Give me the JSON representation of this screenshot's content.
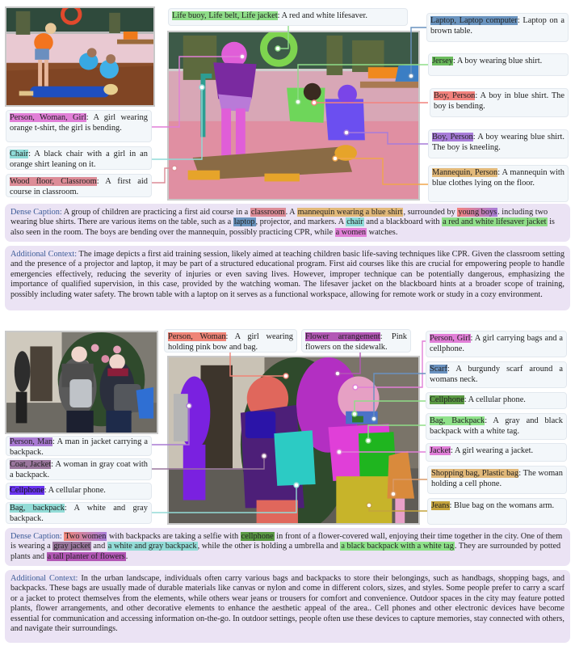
{
  "colors": {
    "girl_pink": "#e17fd7",
    "chair_teal": "#8fdcd8",
    "floor_rose": "#dc8c97",
    "lifebuoy_green": "#8fdd88",
    "laptop_blue": "#6a94bf",
    "jersey_green": "#6bbc5d",
    "boy_red": "#f2827d",
    "boy_purple": "#a77cd9",
    "mannequin_orange": "#e2b97a",
    "person_woman_red": "#ef8477",
    "flower_magenta": "#b257b5",
    "person_man_purple": "#a97ad3",
    "coat_mauve": "#9a769d",
    "cellphone_violet": "#6a35f0",
    "bag_teal": "#93dcd7",
    "scarf_blue": "#6a92c0",
    "cellphone_green": "#5b9a44",
    "backpack_green": "#8fe28a",
    "jacket_pink": "#e07ed8",
    "shopping_tan": "#e2b97a",
    "jeans_olive": "#c4a33c",
    "caption_label": "#3a5a97",
    "caption_bg": "#ebe3f4"
  },
  "panel1": {
    "annotations": {
      "girl": {
        "tag": "Person, Woman, Girl",
        "text": ": A girl wearing orange t-shirt, the girl is bending."
      },
      "chair": {
        "tag": "Chair",
        "text": ": A black chair with a girl in an orange shirt leaning on it."
      },
      "floor": {
        "tag": "Wood floor, Classroom",
        "text": ": A first aid course in classroom."
      },
      "lifebuoy": {
        "tag": "Life buoy, Life belt, Life jacket",
        "text": ":  A red and white lifesaver."
      },
      "laptop": {
        "tag": "Laptop, Laptop computer",
        "text": ": Laptop on a brown table."
      },
      "jersey": {
        "tag": "Jersey",
        "text": ": A boy wearing blue shirt."
      },
      "boy1": {
        "tag": "Boy, Person",
        "text": ": A boy in blue shirt. The boy is bending."
      },
      "boy2": {
        "tag": "Boy, Person",
        "text": ": A boy wearing blue shirt. The boy is kneeling."
      },
      "mannequin": {
        "tag": "Mannequin, Person",
        "text": ": A mannequin with blue clothes lying on the floor."
      }
    },
    "dense_caption": {
      "label": "Dense Caption:",
      "parts": [
        {
          "t": " A group of children are practicing a first aid course in a "
        },
        {
          "t": "classroom",
          "c": "floor_rose"
        },
        {
          "t": ". A "
        },
        {
          "t": "mannequin wearing a blue shirt",
          "c": "mannequin_orange"
        },
        {
          "t": ", surrounded by "
        },
        {
          "t": "young boys",
          "c": "boy_red",
          "c2": "boy_purple"
        },
        {
          "t": ". including two wearing blue shirts. There are various items on the table, such as a "
        },
        {
          "t": "laptop",
          "c": "laptop_blue"
        },
        {
          "t": ", projector, and markers. A "
        },
        {
          "t": "chair",
          "c": "chair_teal"
        },
        {
          "t": " and a blackboard with "
        },
        {
          "t": "a red and white lifesaver jacket",
          "c": "lifebuoy_green"
        },
        {
          "t": " is also seen in the room. The boys are bending over the mannequin, possibly practicing CPR, while "
        },
        {
          "t": "a women",
          "c": "girl_pink"
        },
        {
          "t": " watches."
        }
      ]
    },
    "additional_context": {
      "label": "Additional Context:",
      "text": " The image depicts a first aid training session, likely aimed at teaching children basic life-saving techniques like CPR. Given the classroom setting and the presence of a projector and laptop, it may be part of a structured educational program. First aid courses like this are crucial for empowering people to handle emergencies effectively, reducing the severity of injuries or even saving lives. However, improper technique can be potentially dangerous, emphasizing the importance of qualified supervision, in this case, provided by the watching woman. The lifesaver jacket on the blackboard hints at a broader scope of training, possibly including water safety. The brown table with a laptop on it serves as a functional workspace, allowing for remote work or study in a cozy environment."
    }
  },
  "panel2": {
    "annotations": {
      "man": {
        "tag": "Person, Man",
        "text": ": A man in jacket carrying a backpack."
      },
      "coat": {
        "tag": "Coat, Jacket",
        "text": ":  A woman in gray coat with a backpack."
      },
      "cellphone1": {
        "tag": "Cellphone",
        "text": ": A cellular phone."
      },
      "bag": {
        "tag": "Bag, backpack",
        "text": ": A white and gray backpack."
      },
      "woman": {
        "tag": "Person, Woman",
        "text": ": A girl wearing holding pink bow and bag."
      },
      "flower": {
        "tag": "Flower arrangement",
        "text": ": Pink flowers on the sidewalk."
      },
      "girl": {
        "tag": "Person, Girl",
        "text": ": A girl carrying bags and a cellphone."
      },
      "scarf": {
        "tag": "Scarf",
        "text": ": A burgundy scarf around a womans neck."
      },
      "cellphone2": {
        "tag": "Cellphone",
        "text": ": A cellular phone."
      },
      "backpack": {
        "tag": "Bag, Backpack",
        "text": ": A gray and black backpack with a white tag."
      },
      "jacket": {
        "tag": "Jacket",
        "text": ": A girl wearing a jacket."
      },
      "shopping": {
        "tag": "Shopping bag, Plastic bag",
        "text": ": The woman holding a cell phone."
      },
      "jeans": {
        "tag": "Jeans",
        "text": ": Blue bag on the womans arm."
      }
    },
    "dense_caption": {
      "label": "Dense Caption:",
      "parts": [
        {
          "t": " "
        },
        {
          "t": "Two women",
          "c": "person_woman_red",
          "c2": "boy_purple"
        },
        {
          "t": " with backpacks are taking a selfie with "
        },
        {
          "t": "cellphone",
          "c": "cellphone_green"
        },
        {
          "t": " in front of a flower-covered wall, enjoying their time together in the city. One of them is wearing a "
        },
        {
          "t": "gray jacket",
          "c": "coat_mauve"
        },
        {
          "t": " and "
        },
        {
          "t": "a white and gray backpack",
          "c": "bag_teal"
        },
        {
          "t": ", while the other is holding a umbrella and "
        },
        {
          "t": "a black backpack with a white tag",
          "c": "backpack_green"
        },
        {
          "t": ". They are surrounded by potted plants and "
        },
        {
          "t": "a tall planter of flowers",
          "c": "flower_magenta"
        },
        {
          "t": "."
        }
      ]
    },
    "additional_context": {
      "label": "Additional Context:",
      "text": " In the urban landscape, individuals often carry various bags and backpacks to store their belongings, such as handbags, shopping bags, and backpacks. These bags are usually made of durable materials like canvas or nylon and come in different colors, sizes, and styles. Some people prefer to carry a scarf or a jacket to protect themselves from the elements, while others wear jeans or trousers for comfort and convenience. Outdoor spaces in the city may feature potted plants, flower arrangements, and other decorative elements to enhance the aesthetic appeal of the area.. Cell phones and other electronic devices have become essential for communication and accessing information on-the-go. In outdoor settings, people often use these devices to capture memories, stay connected with others, and navigate their surroundings."
    }
  }
}
